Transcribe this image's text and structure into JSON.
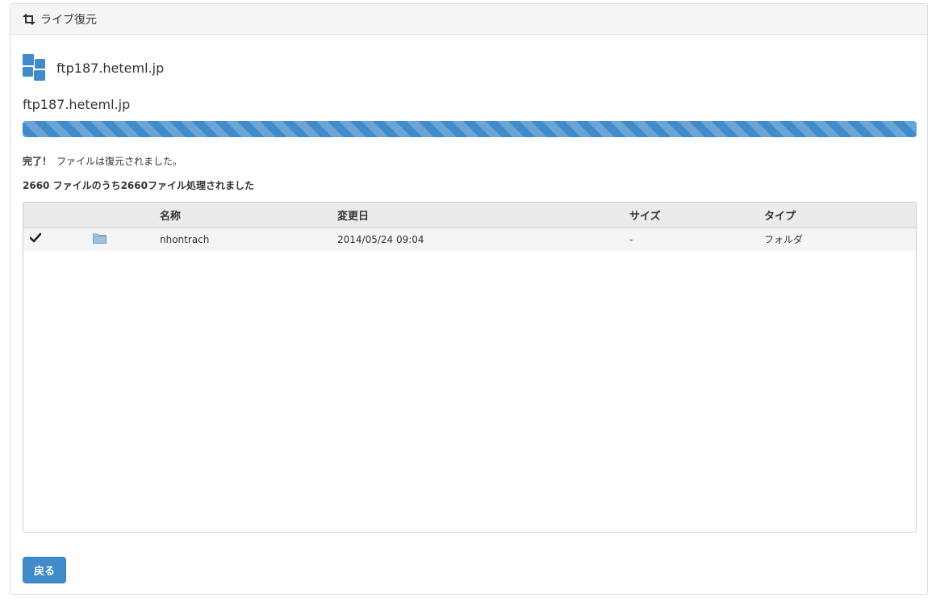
{
  "header": {
    "title": "ライブ復元",
    "icon": "retweet-icon"
  },
  "host": {
    "name": "ftp187.heteml.jp",
    "title": "ftp187.heteml.jp",
    "icon": "server-logo-icon"
  },
  "progress": {
    "percent": 100,
    "color": "#428bca"
  },
  "status": {
    "complete_label": "完了！",
    "complete_message": "ファイルは復元されました。",
    "count_message": "2660 ファイルのうち2660ファイル処理されました"
  },
  "table": {
    "columns": [
      "",
      "",
      "名称",
      "変更日",
      "サイズ",
      "タイプ"
    ],
    "rows": [
      {
        "check_icon": "checkmark-icon",
        "type_icon": "folder-icon",
        "name": "nhontrach",
        "modified": "2014/05/24 09:04",
        "size": "-",
        "type": "フォルダ"
      }
    ]
  },
  "actions": {
    "back_label": "戻る"
  },
  "colors": {
    "accent": "#428bca",
    "folder": "#8fb8dc"
  }
}
